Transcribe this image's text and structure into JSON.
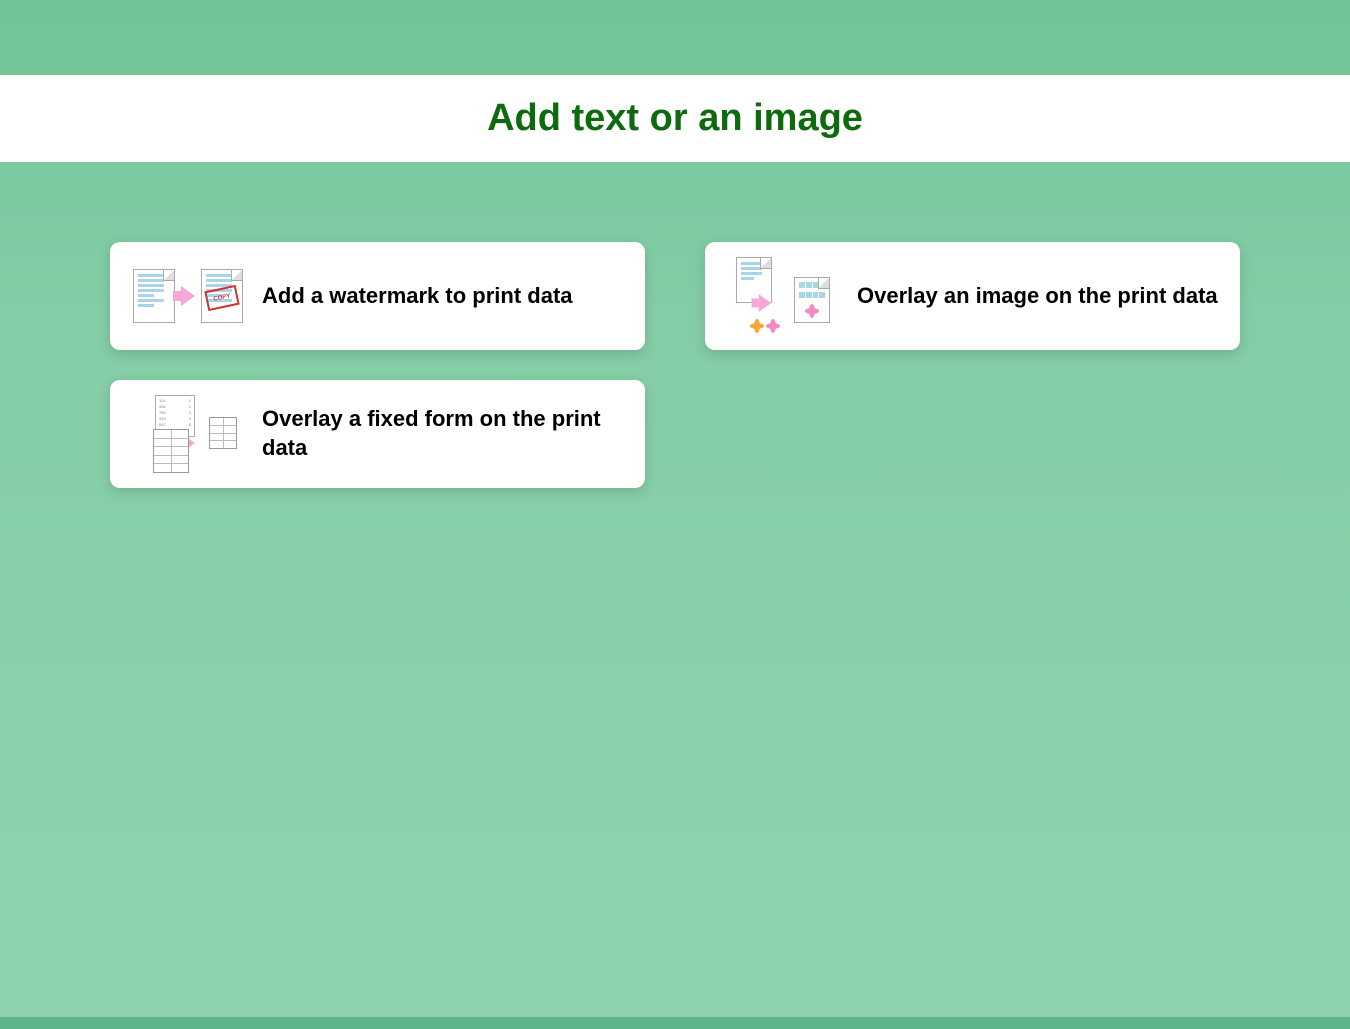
{
  "header": {
    "title": "Add text or an image"
  },
  "cards": [
    {
      "label": "Add a watermark to print data",
      "icon": "watermark-icon"
    },
    {
      "label": "Overlay an image on the print data",
      "icon": "image-overlay-icon"
    },
    {
      "label": "Overlay a fixed form on the print data",
      "icon": "form-overlay-icon"
    }
  ]
}
